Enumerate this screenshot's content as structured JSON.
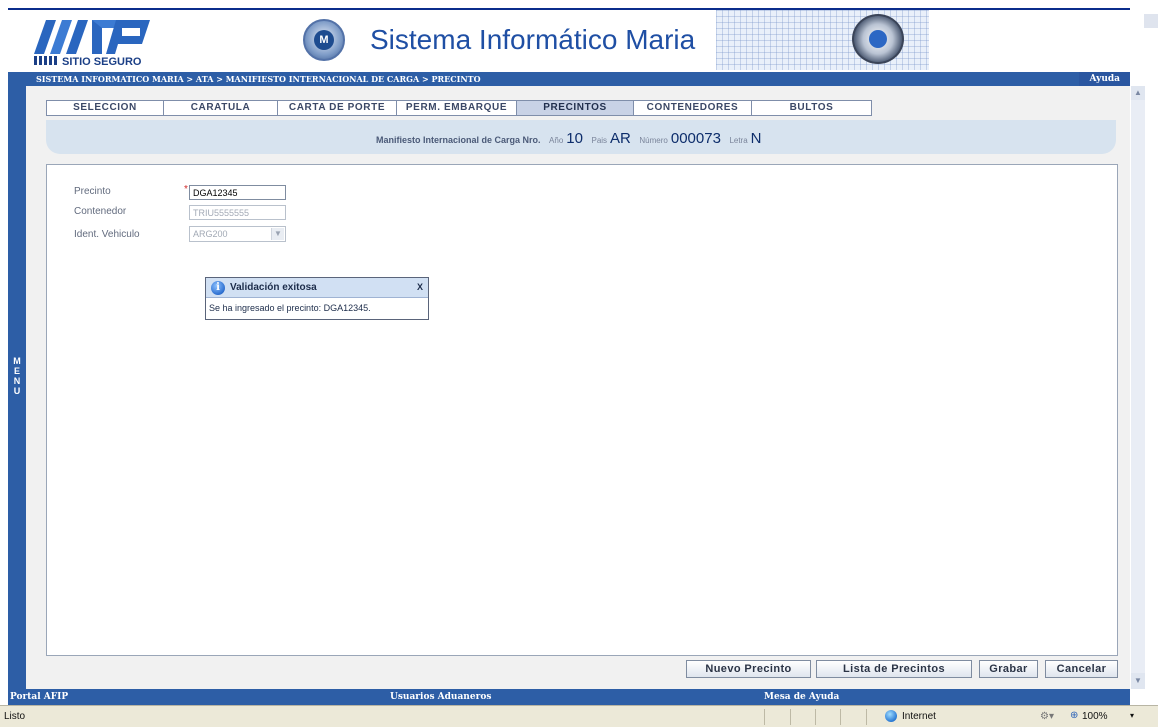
{
  "header": {
    "logo_text": "SITIO SEGURO",
    "app_title": "Sistema Informático Maria"
  },
  "breadcrumb": "SISTEMA INFORMATICO MARIA > ATA > MANIFIESTO INTERNACIONAL DE CARGA > PRECINTO",
  "help_label": "Ayuda",
  "menu_label": [
    "M",
    "E",
    "N",
    "U"
  ],
  "tabs": [
    {
      "label": "SELECCION",
      "active": false
    },
    {
      "label": "CARATULA",
      "active": false
    },
    {
      "label": "CARTA DE PORTE",
      "active": false
    },
    {
      "label": "PERM. EMBARQUE",
      "active": false
    },
    {
      "label": "PRECINTOS",
      "active": true
    },
    {
      "label": "CONTENEDORES",
      "active": false
    },
    {
      "label": "BULTOS",
      "active": false
    }
  ],
  "manifest": {
    "label": "Manifiesto Internacional de Carga Nro.",
    "year_label": "Año",
    "year_value": "10",
    "country_label": "Pais",
    "country_value": "AR",
    "number_label": "Número",
    "number_value": "000073",
    "letter_label": "Letra",
    "letter_value": "N"
  },
  "form": {
    "precinto_label": "Precinto",
    "required_mark": "*",
    "precinto_value": "DGA12345",
    "contenedor_label": "Contenedor",
    "contenedor_value": "TRIU5555555",
    "vehiculo_label": "Ident. Vehiculo",
    "vehiculo_value": "ARG200"
  },
  "dialog": {
    "title": "Validación exitosa",
    "close": "X",
    "message": "Se ha ingresado el precinto: DGA12345."
  },
  "buttons": {
    "nuevo": "Nuevo Precinto",
    "lista": "Lista de Precintos",
    "grabar": "Grabar",
    "cancelar": "Cancelar"
  },
  "footer": {
    "portal": "Portal AFIP",
    "usuarios": "Usuarios Aduaneros",
    "mesa": "Mesa de Ayuda"
  },
  "statusbar": {
    "status": "Listo",
    "zone": "Internet",
    "zoom": "100%"
  },
  "colors": {
    "accent_blue": "#2d5ea6",
    "title_blue": "#1f4fa4",
    "manifest_bar": "#d7e3ef"
  }
}
